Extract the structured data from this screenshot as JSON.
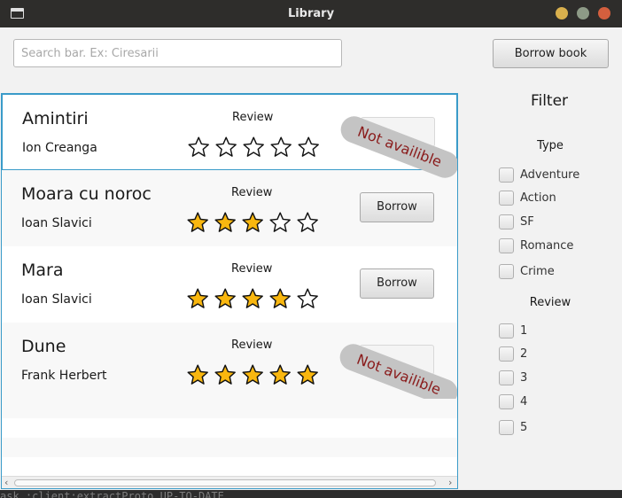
{
  "window": {
    "title": "Library"
  },
  "search": {
    "placeholder": "Search bar. Ex: Ciresarii"
  },
  "toolbar": {
    "borrow_book_label": "Borrow book"
  },
  "list": {
    "review_label": "Review",
    "borrow_label": "Borrow",
    "not_available_label": "Not availible",
    "books": [
      {
        "title": "Amintiri",
        "author": "Ion Creanga",
        "rating": 0,
        "available": false
      },
      {
        "title": "Moara cu noroc",
        "author": "Ioan Slavici",
        "rating": 3,
        "available": true
      },
      {
        "title": "Mara",
        "author": "Ioan Slavici",
        "rating": 4,
        "available": true
      },
      {
        "title": "Dune",
        "author": "Frank Herbert",
        "rating": 5,
        "available": false
      }
    ]
  },
  "filter": {
    "title": "Filter",
    "type_label": "Type",
    "types": [
      "Adventure",
      "Action",
      "SF",
      "Romance",
      "Crime"
    ],
    "review_label": "Review",
    "reviews": [
      "1",
      "2",
      "3",
      "4",
      "5"
    ]
  },
  "colors": {
    "star_filled": "#f9b70f",
    "accent_border": "#3a9bc9",
    "not_available_text": "#8a1c1c"
  },
  "terminal": {
    "text": "ask :client:extractProto UP-TO-DATE"
  }
}
